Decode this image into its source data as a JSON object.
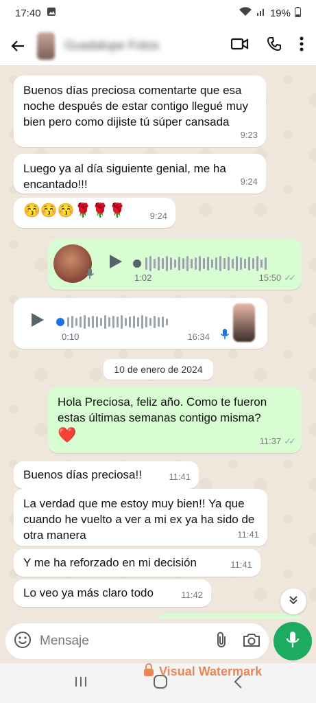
{
  "status": {
    "time": "17:40",
    "battery": "19%"
  },
  "header": {
    "contact_name": "Guadalupe Fotos"
  },
  "messages": [
    {
      "text": "Buenos días preciosa comentarte que esa noche después de estar contigo llegué muy bien pero como dijiste tú súper cansada",
      "time": "9:23"
    },
    {
      "text": "Luego ya al día siguiente genial, me ha encantado!!!",
      "time": "9:24"
    },
    {
      "text": "😚😚😚🌹🌹🌹",
      "time": "9:24"
    },
    {
      "duration": "1:02",
      "time": "15:50"
    },
    {
      "duration": "0:10",
      "time": "16:34"
    },
    {
      "text": "Hola Preciosa, feliz año. Como te fueron estas últimas semanas contigo misma?",
      "emoji": "❤️",
      "time": "11:37"
    },
    {
      "text": "Buenos días preciosa!!",
      "time": "11:41"
    },
    {
      "text": "La verdad que me estoy muy bien!! Ya que cuando he vuelto a ver a mi ex ya ha sido de otra manera",
      "time": "11:41"
    },
    {
      "text": "Y me ha reforzado en mi decisión",
      "time": "11:41"
    },
    {
      "text": "Lo veo ya más claro todo",
      "time": "11:42"
    }
  ],
  "date_separator": "10 de enero de 2024",
  "composer": {
    "placeholder": "Mensaje"
  },
  "watermark": "Visual Watermark",
  "colors": {
    "outgoing_bubble": "#d9fdd3",
    "incoming_bubble": "#ffffff",
    "accent": "#1daa61",
    "audio_dot": "#1a73e8"
  }
}
